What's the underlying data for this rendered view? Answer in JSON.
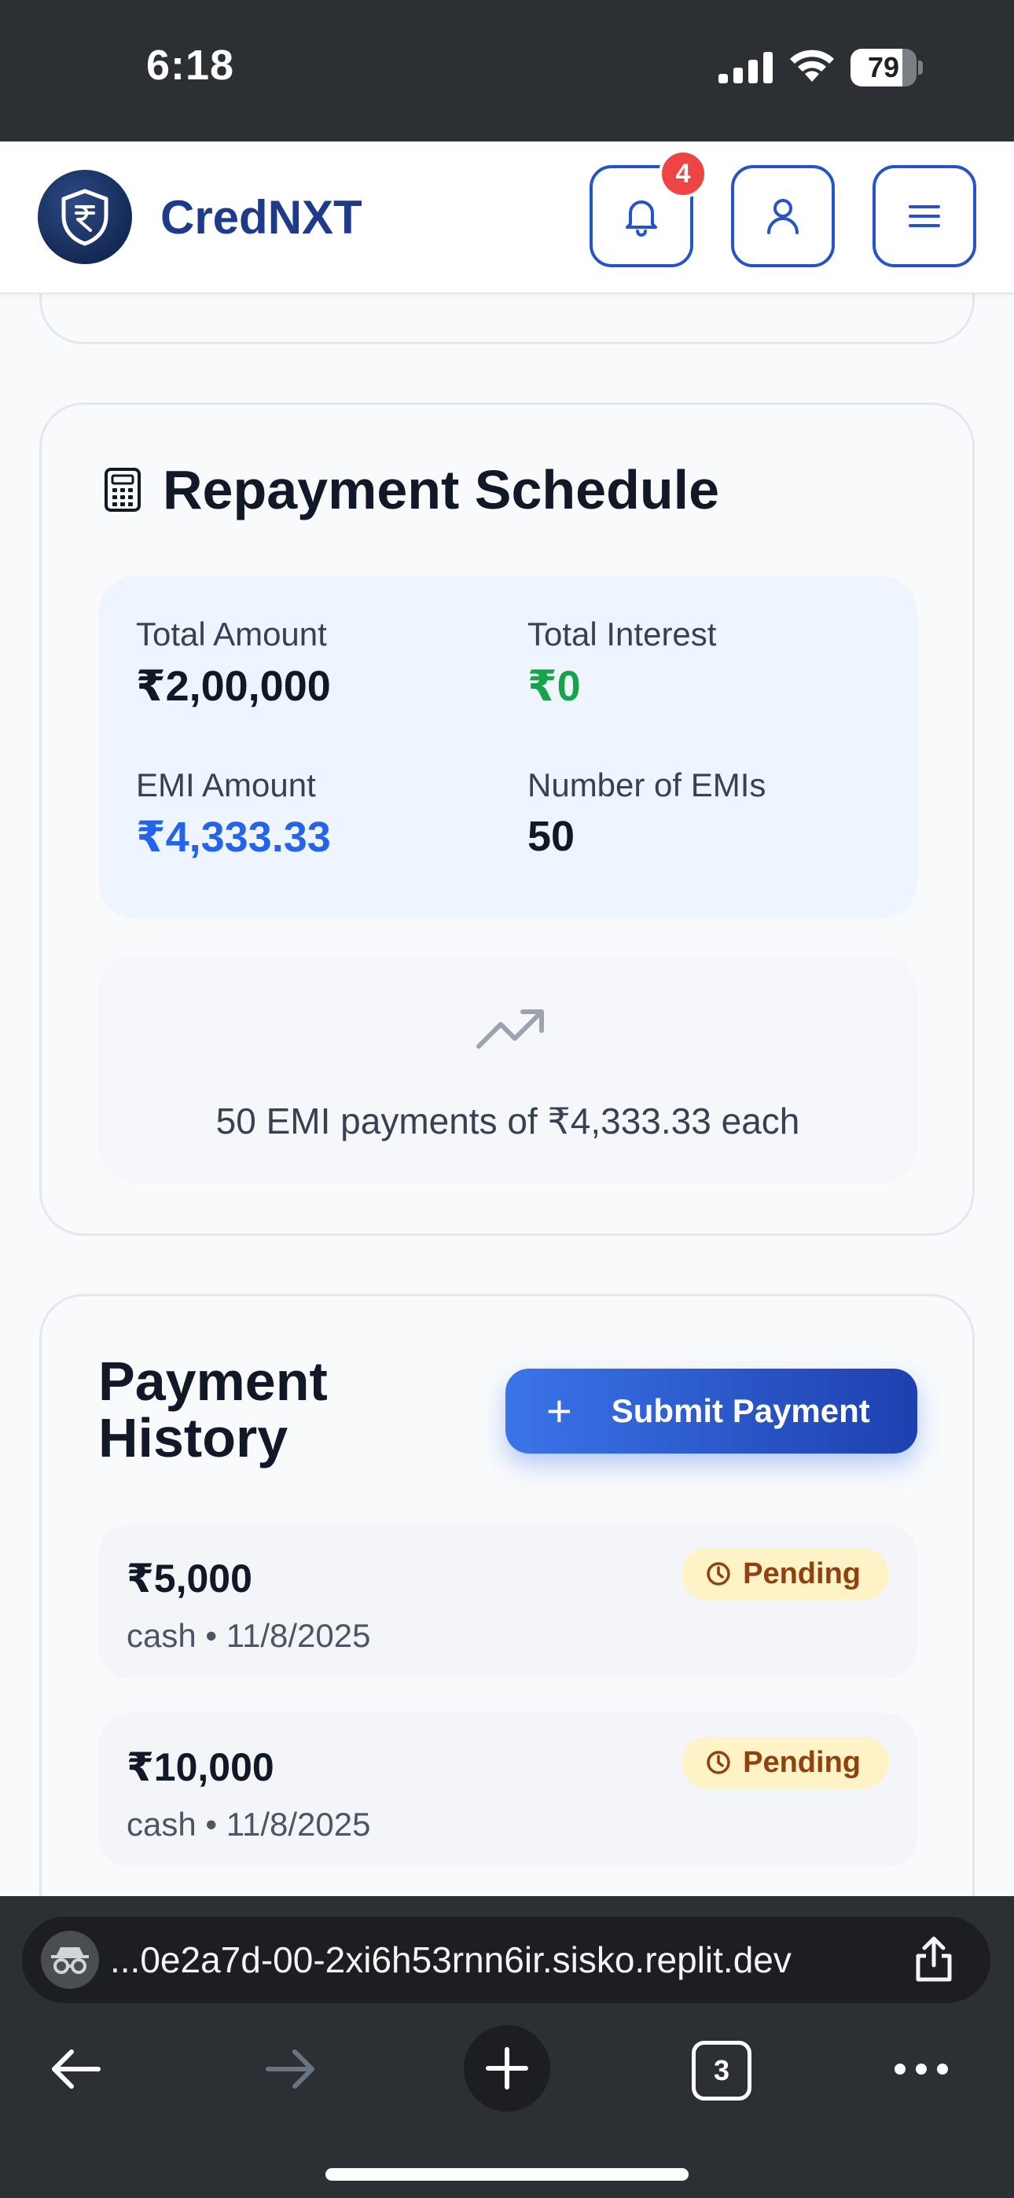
{
  "status_bar": {
    "time": "6:18",
    "battery": "79",
    "battery_level": 0.79
  },
  "header": {
    "brand": "CredNXT",
    "notification_count": "4"
  },
  "schedule": {
    "title": "Repayment Schedule",
    "total_amount_label": "Total Amount",
    "total_amount": "₹2,00,000",
    "total_interest_label": "Total Interest",
    "total_interest": "₹0",
    "emi_amount_label": "EMI Amount",
    "emi_amount": "₹4,333.33",
    "num_emis_label": "Number of EMIs",
    "num_emis": "50",
    "emi_note": "50 EMI payments of ₹4,333.33 each"
  },
  "history": {
    "title": "Payment History",
    "submit_label": "Submit Payment",
    "payments": [
      {
        "amount": "₹5,000",
        "meta": "cash • 11/8/2025",
        "status": "Pending"
      },
      {
        "amount": "₹10,000",
        "meta": "cash • 11/8/2025",
        "status": "Pending"
      }
    ]
  },
  "browser": {
    "url": "...0e2a7d-00-2xi6h53rnn6ir.sisko.replit.dev",
    "tab_count": "3"
  },
  "colors": {
    "brand": "#1e3a8a",
    "accent": "#2563eb",
    "success": "#16a34a",
    "pending_bg": "#fef3c7",
    "pending_text": "#92400e",
    "badge": "#ef4444"
  }
}
